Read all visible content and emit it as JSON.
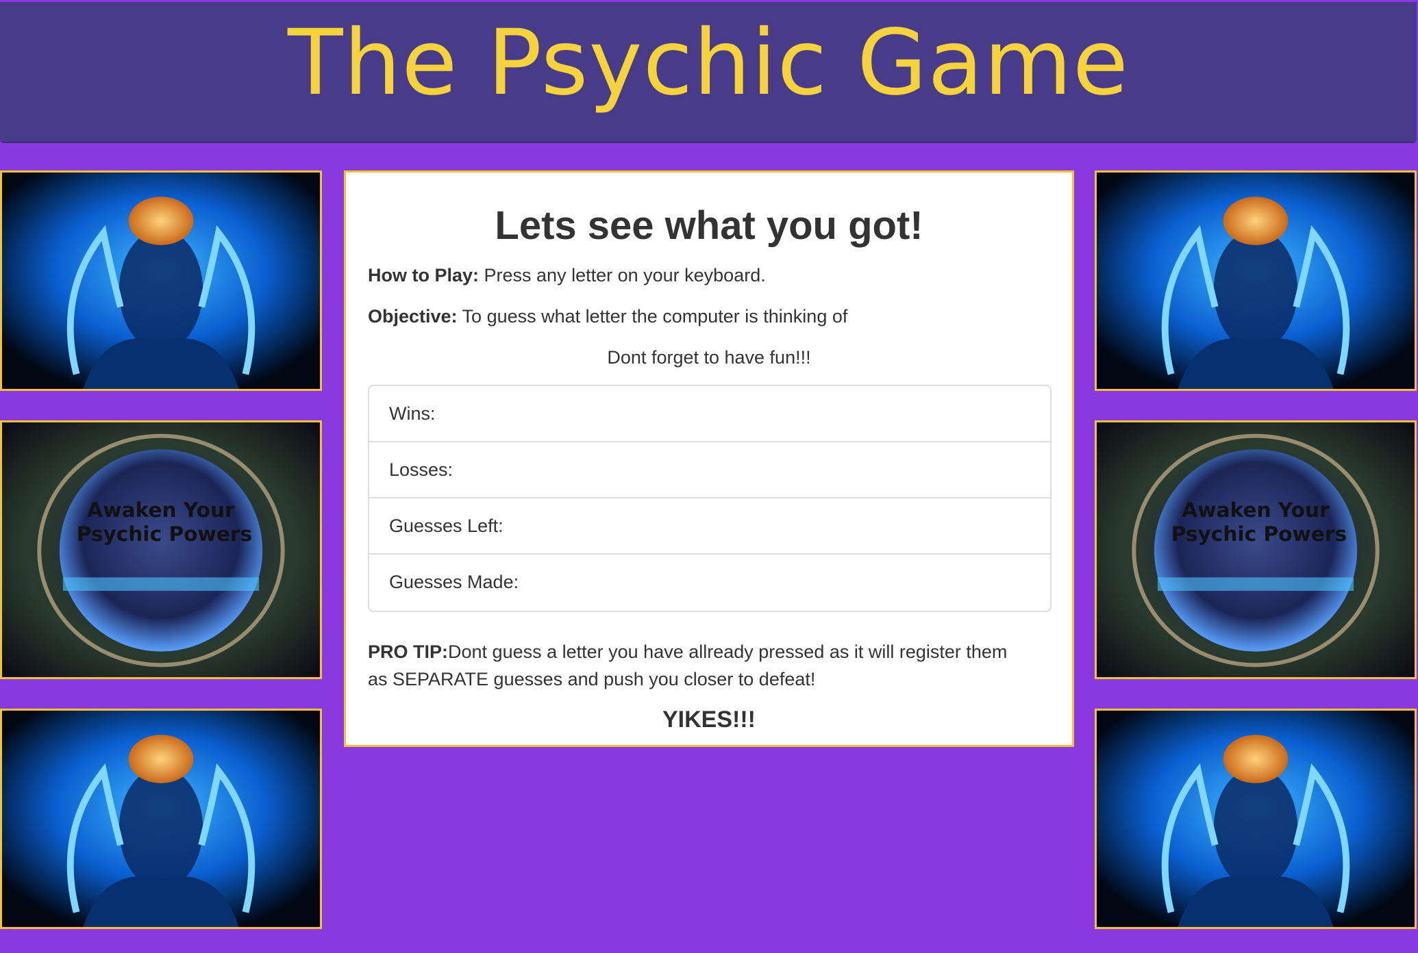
{
  "header": {
    "title": "The Psychic Game"
  },
  "images": {
    "awaken_text_line1": "Awaken Your",
    "awaken_text_line2": "Psychic Powers"
  },
  "panel": {
    "heading": "Lets see what you got!",
    "how_to_play_label": "How to Play:",
    "how_to_play_text": " Press any letter on your keyboard.",
    "objective_label": "Objective:",
    "objective_text": " To guess what letter the computer is thinking of",
    "fun_text": "Dont forget to have fun!!!",
    "stats": [
      {
        "label": "Wins:"
      },
      {
        "label": "Losses:"
      },
      {
        "label": "Guesses Left:"
      },
      {
        "label": "Guesses Made:"
      }
    ],
    "pro_tip_label": "PRO TIP:",
    "pro_tip_line1": "Dont guess a letter you have allready pressed as it will register them",
    "pro_tip_line2": "as SEPARATE guesses and push you closer to defeat!",
    "yikes": "YIKES!!!"
  },
  "colors": {
    "background": "#8a38e0",
    "header": "#483c8a",
    "title": "#f7d33b",
    "border": "#f2c530"
  }
}
